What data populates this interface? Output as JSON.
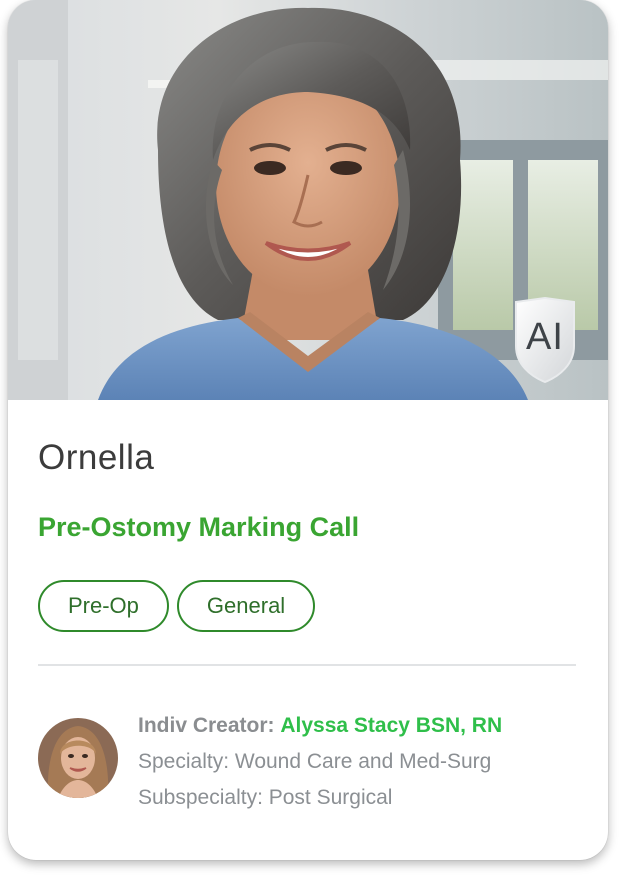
{
  "card": {
    "name": "Ornella",
    "call_title": "Pre-Ostomy Marking Call",
    "tags": [
      "Pre-Op",
      "General"
    ],
    "badge": "AI",
    "hero_image": "portrait-photo",
    "creator": {
      "label": "Indiv Creator:",
      "name": "Alyssa Stacy BSN, RN",
      "specialty": "Specialty: Wound Care and Med-Surg",
      "subspecialty": "Subspecialty: Post Surgical"
    }
  },
  "colors": {
    "accent_green": "#3aa532",
    "creator_green": "#2fbf4a",
    "tag_border": "#2f8a2b",
    "text_gray": "#8b8f93",
    "name_text": "#3c3c3c"
  }
}
